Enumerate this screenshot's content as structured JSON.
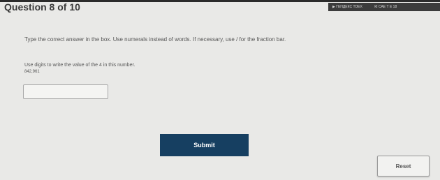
{
  "header": {
    "title": "Question 8 of 10",
    "status_left": "▶ ГЕНДЕКС ТОЕХ",
    "status_right": "КІ САЕ Т Е 18"
  },
  "question": {
    "instructions": "Type the correct answer in the box. Use numerals instead of words. If necessary, use / for the fraction bar.",
    "prompt": "Use digits to write the value of the 4 in this number.",
    "number": "842,961"
  },
  "answer": {
    "value": "",
    "placeholder": ""
  },
  "buttons": {
    "submit_label": "Submit",
    "reset_label": "Reset"
  },
  "colors": {
    "submit_bg": "#163f61",
    "background": "#e9e9e7"
  }
}
